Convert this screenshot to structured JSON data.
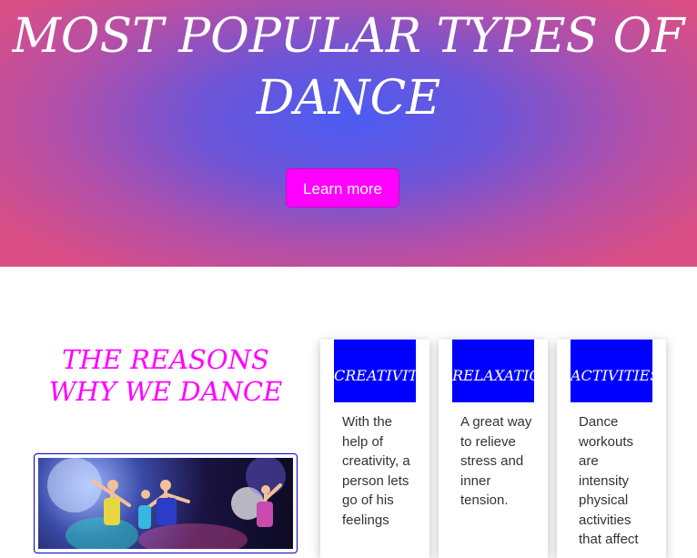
{
  "hero": {
    "title": "MOST POPULAR TYPES OF DANCE",
    "button_label": "Learn more"
  },
  "reasons": {
    "title": "THE REASONS WHY WE DANCE"
  },
  "cards": [
    {
      "heading": "CREATIVITY",
      "text": "With the help of creativity, a person lets go of his feelings"
    },
    {
      "heading": "RELAXATIO",
      "text": "A great way to relieve stress and inner tension."
    },
    {
      "heading": "ACTIVITIES",
      "text": "Dance workouts are intensity physical activities that affect"
    }
  ],
  "colors": {
    "accent_magenta": "#ff00ff",
    "card_heading_blue": "#0000ff",
    "photo_border": "#0000cc"
  },
  "images": {
    "photo": "dancers-stage-photo"
  }
}
